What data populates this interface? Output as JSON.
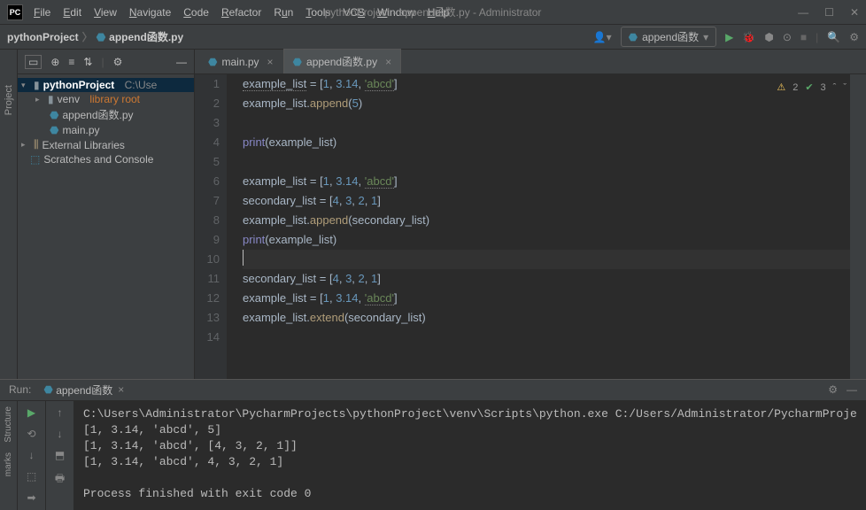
{
  "title": "pythonProject - append函数.py - Administrator",
  "menu": [
    "File",
    "Edit",
    "View",
    "Navigate",
    "Code",
    "Refactor",
    "Run",
    "Tools",
    "VCS",
    "Window",
    "Help"
  ],
  "menu_underline": [
    "F",
    "E",
    "V",
    "N",
    "C",
    "R",
    "R",
    "T",
    "V",
    "W",
    "H"
  ],
  "breadcrumb": {
    "proj": "pythonProject",
    "file": "append函数.py"
  },
  "run_config": "append函数",
  "proj_tree": {
    "root": "pythonProject",
    "root_path": "C:\\Use",
    "venv": "venv",
    "venv_tag": "library root",
    "files": [
      "append函数.py",
      "main.py"
    ],
    "ext_lib": "External Libraries",
    "scratches": "Scratches and Console"
  },
  "tabs": [
    {
      "name": "main.py",
      "active": false
    },
    {
      "name": "append函数.py",
      "active": true
    }
  ],
  "editor_status": {
    "warnings": "2",
    "typos": "3"
  },
  "code_lines": [
    "example_list = [1, 3.14, 'abcd']",
    "example_list.append(5)",
    "",
    "print(example_list)",
    "",
    "example_list = [1, 3.14, 'abcd']",
    "secondary_list = [4, 3, 2, 1]",
    "example_list.append(secondary_list)",
    "print(example_list)",
    "",
    "secondary_list = [4, 3, 2, 1]",
    "example_list = [1, 3.14, 'abcd']",
    "example_list.extend(secondary_list)",
    ""
  ],
  "run_label": "Run:",
  "run_tab": "append函数",
  "console_lines": [
    "C:\\Users\\Administrator\\PycharmProjects\\pythonProject\\venv\\Scripts\\python.exe C:/Users/Administrator/PycharmProje",
    "[1, 3.14, 'abcd', 5]",
    "[1, 3.14, 'abcd', [4, 3, 2, 1]]",
    "[1, 3.14, 'abcd', 4, 3, 2, 1]",
    "",
    "Process finished with exit code 0"
  ],
  "left_labels": {
    "project": "Project",
    "structure": "Structure",
    "marks": "marks"
  }
}
